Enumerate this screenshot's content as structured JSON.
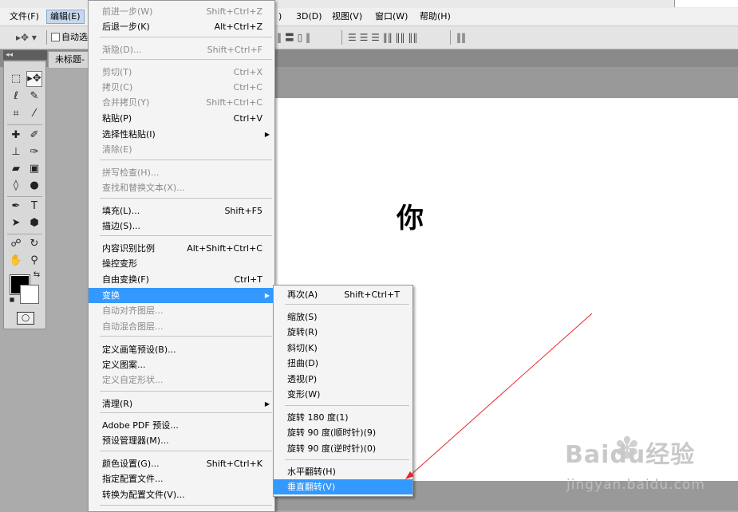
{
  "menubar": {
    "items": [
      {
        "label": "文件(F)"
      },
      {
        "label": "编辑(E)"
      },
      {
        "label": ")"
      },
      {
        "label": "3D(D)"
      },
      {
        "label": "视图(V)"
      },
      {
        "label": "窗口(W)"
      },
      {
        "label": "帮助(H)"
      }
    ]
  },
  "options": {
    "auto_select_label": "自动选"
  },
  "tabs": {
    "collapse": "◂◂",
    "doc_tab": "未标题-"
  },
  "canvas": {
    "text": "你"
  },
  "edit_menu": {
    "items": [
      {
        "label": "前进一步(W)",
        "shortcut": "Shift+Ctrl+Z",
        "disabled": true
      },
      {
        "label": "后退一步(K)",
        "shortcut": "Alt+Ctrl+Z",
        "disabled": false
      },
      {
        "label": "渐隐(D)...",
        "shortcut": "Shift+Ctrl+F",
        "disabled": true
      },
      {
        "label": "剪切(T)",
        "shortcut": "Ctrl+X",
        "disabled": true
      },
      {
        "label": "拷贝(C)",
        "shortcut": "Ctrl+C",
        "disabled": true
      },
      {
        "label": "合并拷贝(Y)",
        "shortcut": "Shift+Ctrl+C",
        "disabled": true
      },
      {
        "label": "粘贴(P)",
        "shortcut": "Ctrl+V",
        "disabled": false
      },
      {
        "label": "选择性粘贴(I)",
        "shortcut": "",
        "disabled": false,
        "submenu": true
      },
      {
        "label": "清除(E)",
        "shortcut": "",
        "disabled": true
      },
      {
        "label": "拼写检查(H)...",
        "shortcut": "",
        "disabled": true
      },
      {
        "label": "查找和替换文本(X)...",
        "shortcut": "",
        "disabled": true
      },
      {
        "label": "填充(L)...",
        "shortcut": "Shift+F5",
        "disabled": false
      },
      {
        "label": "描边(S)...",
        "shortcut": "",
        "disabled": false
      },
      {
        "label": "内容识别比例",
        "shortcut": "Alt+Shift+Ctrl+C",
        "disabled": false
      },
      {
        "label": "操控变形",
        "shortcut": "",
        "disabled": false
      },
      {
        "label": "自由变换(F)",
        "shortcut": "Ctrl+T",
        "disabled": false
      },
      {
        "label": "变换",
        "shortcut": "",
        "disabled": false,
        "submenu": true,
        "highlighted": true
      },
      {
        "label": "自动对齐图层...",
        "shortcut": "",
        "disabled": true
      },
      {
        "label": "自动混合图层...",
        "shortcut": "",
        "disabled": true
      },
      {
        "label": "定义画笔预设(B)...",
        "shortcut": "",
        "disabled": false
      },
      {
        "label": "定义图案...",
        "shortcut": "",
        "disabled": false
      },
      {
        "label": "定义自定形状...",
        "shortcut": "",
        "disabled": true
      },
      {
        "label": "清理(R)",
        "shortcut": "",
        "disabled": false,
        "submenu": true
      },
      {
        "label": "Adobe PDF 预设...",
        "shortcut": "",
        "disabled": false
      },
      {
        "label": "预设管理器(M)...",
        "shortcut": "",
        "disabled": false
      },
      {
        "label": "颜色设置(G)...",
        "shortcut": "Shift+Ctrl+K",
        "disabled": false
      },
      {
        "label": "指定配置文件...",
        "shortcut": "",
        "disabled": false
      },
      {
        "label": "转换为配置文件(V)...",
        "shortcut": "",
        "disabled": false
      }
    ]
  },
  "transform_menu": {
    "items": [
      {
        "label": "再次(A)",
        "shortcut": "Shift+Ctrl+T"
      },
      {
        "label": "缩放(S)",
        "shortcut": ""
      },
      {
        "label": "旋转(R)",
        "shortcut": ""
      },
      {
        "label": "斜切(K)",
        "shortcut": ""
      },
      {
        "label": "扭曲(D)",
        "shortcut": ""
      },
      {
        "label": "透视(P)",
        "shortcut": ""
      },
      {
        "label": "变形(W)",
        "shortcut": ""
      },
      {
        "label": "旋转 180 度(1)",
        "shortcut": ""
      },
      {
        "label": "旋转 90 度(顺时针)(9)",
        "shortcut": ""
      },
      {
        "label": "旋转 90 度(逆时针)(0)",
        "shortcut": ""
      },
      {
        "label": "水平翻转(H)",
        "shortcut": ""
      },
      {
        "label": "垂直翻转(V)",
        "shortcut": "",
        "highlighted": true
      }
    ]
  },
  "watermark": {
    "logo": "Baidu经验",
    "url": "jingyan.baidu.com"
  },
  "colors": {
    "highlight": "#3399ff",
    "annotation_arrow": "#e8242c"
  }
}
